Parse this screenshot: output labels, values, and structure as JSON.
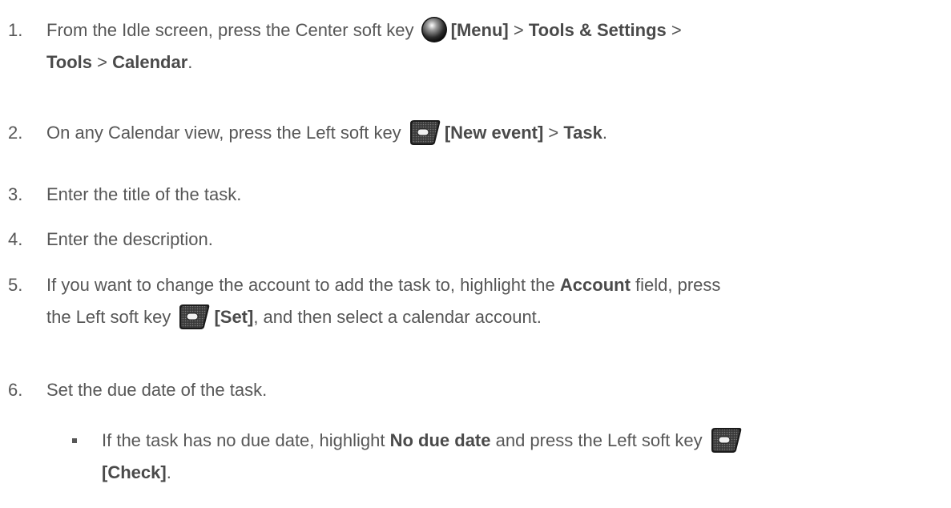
{
  "steps": [
    {
      "number": "1.",
      "parts": {
        "a": "From the Idle screen, press the Center soft key",
        "b": "[Menu]",
        "c": " > ",
        "d": "Tools & Settings",
        "e": " > ",
        "f": "Tools",
        "g": " > ",
        "h": "Calendar",
        "i": "."
      },
      "key_icon": "center-soft-key-icon"
    },
    {
      "number": "2.",
      "parts": {
        "a": "On any Calendar view, press the Left soft key",
        "b": "[New event]",
        "c": " > ",
        "d": "Task",
        "e": "."
      },
      "key_icon": "left-soft-key-icon"
    },
    {
      "number": "3.",
      "text": "Enter the title of the task."
    },
    {
      "number": "4.",
      "text": "Enter the description."
    },
    {
      "number": "5.",
      "parts": {
        "a": "If you want to change the account to add the task to, highlight the ",
        "b": "Account",
        "c": " field, press",
        "d": "the Left soft key",
        "e": "[Set]",
        "f": ", and then select a calendar account."
      },
      "key_icon": "left-soft-key-icon"
    },
    {
      "number": "6.",
      "text": "Set the due date of the task."
    }
  ],
  "sub_bullet": {
    "parts": {
      "a": "If the task has no due date, highlight ",
      "b": "No due date",
      "c": " and press the Left soft key",
      "d": "[Check]",
      "e": "."
    },
    "key_icon": "left-soft-key-icon"
  }
}
